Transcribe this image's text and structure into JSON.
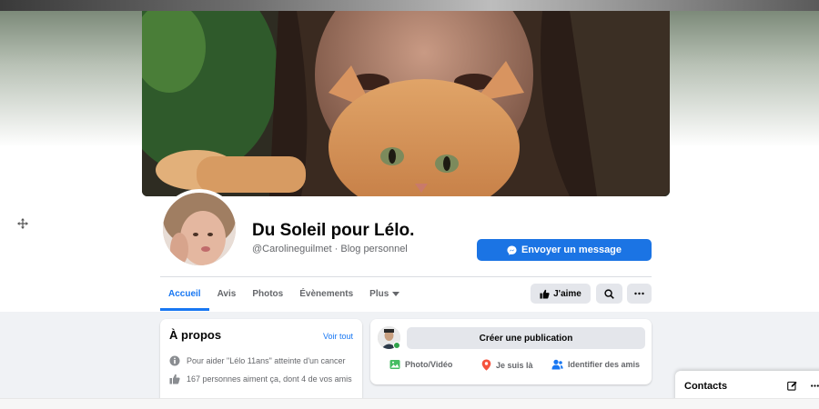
{
  "page": {
    "title": "Du Soleil pour Lélo.",
    "subtitle": "@Carolineguilmet · Blog personnel"
  },
  "header": {
    "message_button": "Envoyer un message",
    "like_button": "J'aime"
  },
  "tabs": [
    {
      "label": "Accueil",
      "active": true
    },
    {
      "label": "Avis"
    },
    {
      "label": "Photos"
    },
    {
      "label": "Évènements"
    },
    {
      "label": "Plus"
    }
  ],
  "about": {
    "title": "À propos",
    "see_all": "Voir tout",
    "rows": [
      {
        "icon": "info-icon",
        "text": "Pour aider \"Lélo 11ans\" atteinte d'un cancer"
      },
      {
        "icon": "thumbs-up-icon",
        "text": "167 personnes aiment ça, dont 4 de vos amis"
      }
    ]
  },
  "composer": {
    "create_label": "Créer une publication",
    "actions": [
      {
        "icon": "photo-icon",
        "label": "Photo/Vidéo",
        "color": "#45bd62"
      },
      {
        "icon": "location-pin-icon",
        "label": "Je suis là",
        "color": "#f5533d"
      },
      {
        "icon": "tag-people-icon",
        "label": "Identifier des amis",
        "color": "#1877f2"
      }
    ]
  },
  "contacts": {
    "label": "Contacts"
  },
  "colors": {
    "accent": "#1877f2",
    "button": "#1b74e4"
  }
}
